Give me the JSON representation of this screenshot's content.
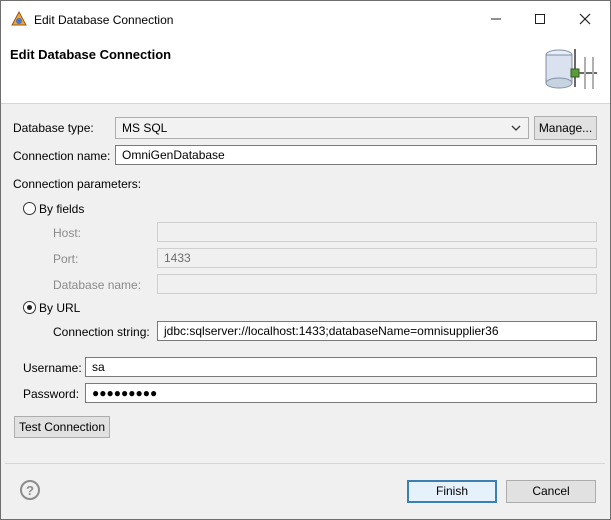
{
  "window": {
    "title": "Edit Database Connection",
    "minimize_icon": "minimize-icon",
    "maximize_icon": "maximize-icon",
    "close_icon": "close-icon"
  },
  "header": {
    "title": "Edit Database Connection",
    "banner_icon": "database-icon"
  },
  "form": {
    "database_type": {
      "label": "Database type:",
      "value": "MS SQL",
      "manage_label": "Manage..."
    },
    "connection_name": {
      "label": "Connection name:",
      "value": "OmniGenDatabase"
    },
    "connection_parameters_label": "Connection parameters:",
    "by_fields": {
      "label": "By fields",
      "selected": false,
      "host": {
        "label": "Host:",
        "value": ""
      },
      "port": {
        "label": "Port:",
        "value": "1433"
      },
      "database_name": {
        "label": "Database name:",
        "value": ""
      }
    },
    "by_url": {
      "label": "By URL",
      "selected": true,
      "connection_string": {
        "label": "Connection string:",
        "value": "jdbc:sqlserver://localhost:1433;databaseName=omnisupplier36"
      }
    },
    "username": {
      "label": "Username:",
      "value": "sa"
    },
    "password": {
      "label": "Password:",
      "value": "●●●●●●●●●"
    },
    "test_connection_label": "Test Connection"
  },
  "footer": {
    "help_icon": "help-icon",
    "help_glyph": "?",
    "finish_label": "Finish",
    "cancel_label": "Cancel"
  },
  "colors": {
    "default_button_border": "#3c7fb1",
    "dialog_bg": "#f0f0f0"
  }
}
